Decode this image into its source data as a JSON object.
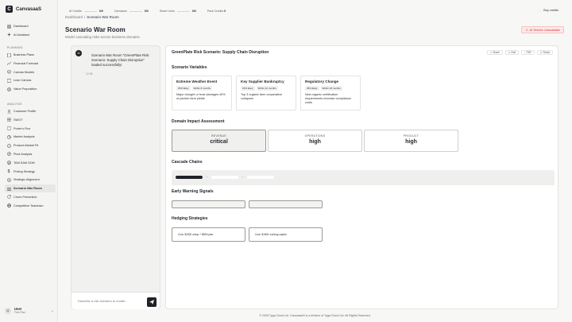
{
  "app": {
    "name": "CanvasaaS",
    "logo_letter": "C"
  },
  "topbar": {
    "credits": [
      {
        "label": "AI Credits",
        "count": "0/0"
      },
      {
        "label": "Canvases",
        "count": "0/0"
      },
      {
        "label": "Share Links",
        "count": "0/0"
      },
      {
        "label": "Pack Credits",
        "count": "0"
      }
    ],
    "dots": "···",
    "buy_label": "Buy credits"
  },
  "sidebar": {
    "top_items": [
      {
        "label": "Dashboard",
        "icon": "grid-icon"
      },
      {
        "label": "AI Assistant",
        "icon": "sparkle-icon"
      }
    ],
    "planning_label": "Planning",
    "planning_items": [
      {
        "label": "Business Plans",
        "icon": "document-icon"
      },
      {
        "label": "Financial Forecast",
        "icon": "chart-icon"
      },
      {
        "label": "Canvas Models",
        "icon": "layers-icon"
      },
      {
        "label": "Lean Canvas",
        "icon": "canvas-icon"
      },
      {
        "label": "Value Proposition",
        "icon": "target-icon"
      }
    ],
    "analysis_label": "Analysis",
    "analysis_items": [
      {
        "label": "Customer Profile",
        "icon": "user-icon"
      },
      {
        "label": "SWOT",
        "icon": "grid-icon"
      },
      {
        "label": "Porter's Five",
        "icon": "shield-icon"
      },
      {
        "label": "Market Analysis",
        "icon": "pie-icon"
      },
      {
        "label": "Product-Market Fit",
        "icon": "check-circle-icon"
      },
      {
        "label": "Pivot Analysis",
        "icon": "compass-icon"
      },
      {
        "label": "TAM SAM SOM",
        "icon": "circle-icon"
      },
      {
        "label": "Pricing Strategy",
        "icon": "dollar-icon"
      },
      {
        "label": "Strategic Alignment",
        "icon": "target-icon"
      },
      {
        "label": "Scenario War Room",
        "icon": "stack-icon",
        "active": true
      },
      {
        "label": "Churn Prevention",
        "icon": "refresh-icon"
      },
      {
        "label": "Competitive Teardown",
        "icon": "globe-icon"
      }
    ],
    "user": {
      "initial": "U",
      "name": "User",
      "plan": "Free Plan"
    }
  },
  "breadcrumb": {
    "root": "Dashboard",
    "sep": "/",
    "current": "Scenario War Room"
  },
  "header": {
    "title": "Scenario War Room",
    "subtitle": "Model cascading risks across business domains",
    "alert": "AI Service Unavailable"
  },
  "chat": {
    "bot_initial": "AI",
    "message": "Scenario War Room \"GreenPlate Risk Scenario: Supply Chain Disruption\" loaded successfully!",
    "time": "12:35",
    "input_placeholder": "Describe a risk scenario to model..."
  },
  "scenario": {
    "title": "GreenPlate Risk Scenario: Supply Chain Disruption",
    "tools": [
      "Share",
      "Edit",
      "PDF",
      "Reset"
    ],
    "variables_title": "Scenario Variables",
    "variables": [
      {
        "name": "Extreme Weather Event",
        "likelihood": "25% likely",
        "timeframe": "Within 6 months",
        "desc": "Major drought or frost damages 40% of partner farm yields"
      },
      {
        "name": "Key Supplier Bankruptcy",
        "likelihood": "15% likely",
        "timeframe": "Within 12 months",
        "desc": "Top 3 organic farm cooperative collapses"
      },
      {
        "name": "Regulatory Change",
        "likelihood": "35% likely",
        "timeframe": "Within 18 months",
        "desc": "New organic certification requirements increase compliance costs"
      }
    ],
    "impact_title": "Domain Impact Assessment",
    "impacts": [
      {
        "domain": "Revenue",
        "level": "critical"
      },
      {
        "domain": "Operations",
        "level": "high"
      },
      {
        "domain": "Product",
        "level": "high"
      }
    ],
    "cascade_title": "Cascade Chains",
    "cascade_arrow": "→",
    "signals_title": "Early Warning Signals",
    "hedging_title": "Hedging Strategies",
    "hedges": [
      {
        "cost": "Cost: $200K setup + $50K/year"
      },
      {
        "cost": "Cost: $150K working capital"
      }
    ],
    "colors": {
      "accent": "#1f2328",
      "alert": "#dd3333"
    }
  },
  "footer": "© 2026 Tyga Cloud Ltd. CanvasaaS is a division of Tyga Cloud Ltd. All Rights Reserved."
}
